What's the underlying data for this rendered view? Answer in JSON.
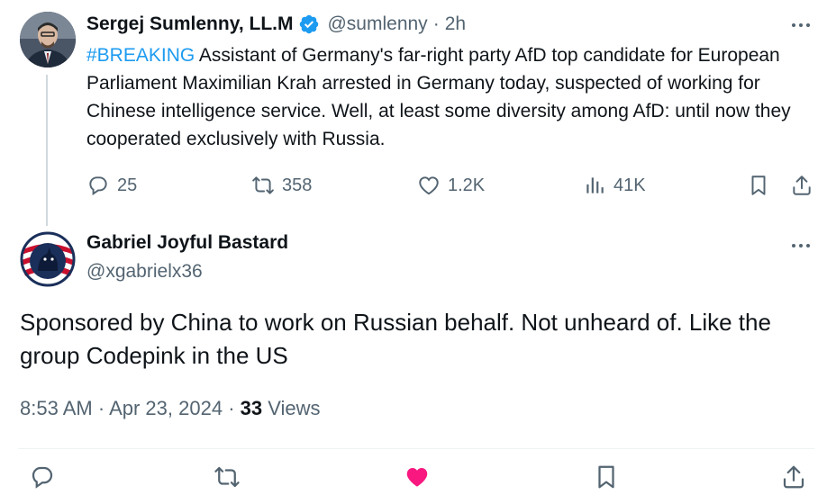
{
  "tweet": {
    "author_name": "Sergej Sumlenny, LL.M",
    "handle": "@sumlenny",
    "time_sep": "·",
    "time": "2h",
    "hashtag": "#BREAKING",
    "text": "Assistant of Germany's far-right party AfD top candidate for European Parliament Maximilian Krah arrested in Germany today, suspected of working for Chinese intelligence service. Well, at least some diversity among AfD: until now they cooperated exclusively with Russia.",
    "actions": {
      "replies": "25",
      "reposts": "358",
      "likes": "1.2K",
      "views": "41K"
    }
  },
  "reply": {
    "author_name": "Gabriel Joyful Bastard",
    "handle": "@xgabrielx36",
    "text": "Sponsored by China to work on Russian behalf. Not unheard of. Like the group Codepink in the US",
    "time": "8:53 AM",
    "sep": "·",
    "date": "Apr 23, 2024",
    "views_count": "33",
    "views_label": "Views"
  },
  "colors": {
    "accent": "#1d9bf0",
    "secondary_text": "#536471",
    "like_active": "#f91880"
  }
}
